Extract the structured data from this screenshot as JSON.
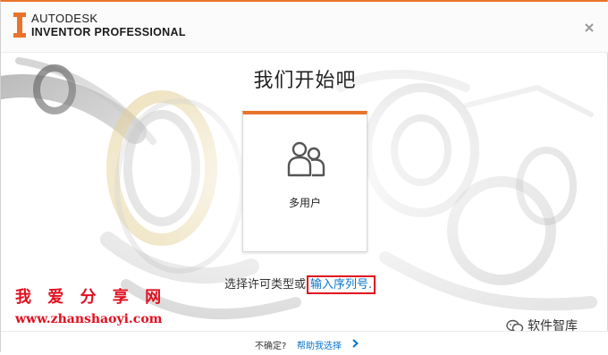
{
  "window": {
    "brand_line1": "AUTODESK",
    "brand_line2": "INVENTOR PROFESSIONAL",
    "close_symbol": "×",
    "accent_color": "#e8742b"
  },
  "main": {
    "heading": "我们开始吧",
    "card": {
      "label": "多用户",
      "icon": "users-icon"
    },
    "license_prompt": "选择许可类型或",
    "serial_link": "输入序列号",
    "serial_link_suffix": ".",
    "link_color": "#0a74c9"
  },
  "watermark": {
    "site_name": "我 爱 分 享 网",
    "site_url": "www.zhanshaoyi.com",
    "wechat_label": "软件智库",
    "color": "#e01020"
  },
  "footer": {
    "question": "不确定?",
    "help_link": "帮助我选择"
  }
}
